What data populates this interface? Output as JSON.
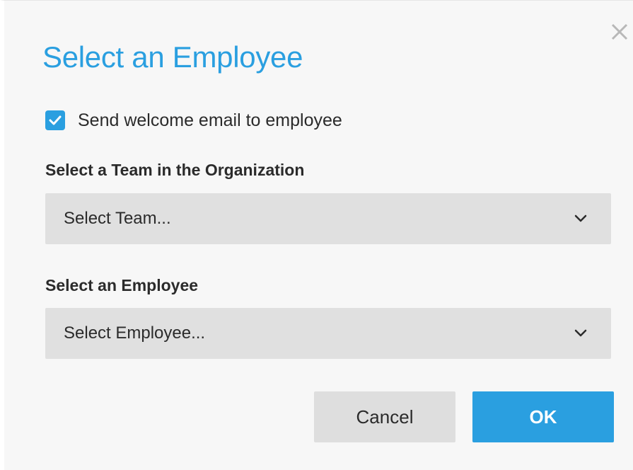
{
  "dialog": {
    "title": "Select an Employee",
    "close_icon": "close-icon"
  },
  "welcome_email": {
    "label": "Send welcome email to employee",
    "checked": true
  },
  "team_field": {
    "label": "Select a Team in the Organization",
    "value": "Select Team..."
  },
  "employee_field": {
    "label": "Select an Employee",
    "value": "Select Employee..."
  },
  "buttons": {
    "cancel_label": "Cancel",
    "ok_label": "OK"
  },
  "colors": {
    "accent": "#2a9fe0",
    "dialog_background": "#f7f7f7",
    "select_background": "#e0e0e0",
    "cancel_background": "#dedede"
  }
}
